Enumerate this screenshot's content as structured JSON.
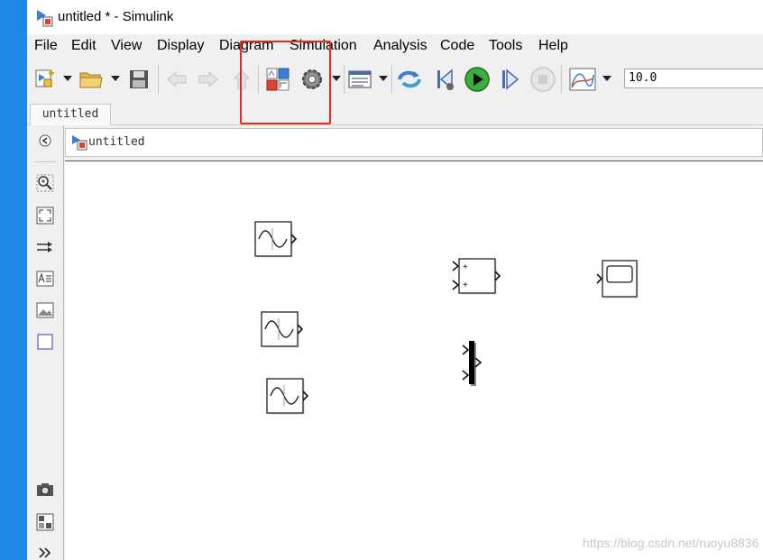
{
  "window": {
    "title": "untitled * - Simulink"
  },
  "menu": {
    "file": "File",
    "edit": "Edit",
    "view": "View",
    "display": "Display",
    "diagram": "Diagram",
    "simulation": "Simulation",
    "analysis": "Analysis",
    "code": "Code",
    "tools": "Tools",
    "help": "Help"
  },
  "toolbar": {
    "stop_time": "10.0"
  },
  "tabs": {
    "model_tab": "untitled"
  },
  "address": {
    "path": "untitled"
  },
  "blocks": {
    "sine1": "sine-wave",
    "sine2": "sine-wave",
    "sine3": "sine-wave",
    "sum": "sum",
    "mux": "mux",
    "scope": "scope"
  },
  "sum_block": {
    "sign1": "+",
    "sign2": "+"
  },
  "watermark": "https://blog.csdn.net/ruoyu8836",
  "colors": {
    "highlight": "#e8291c",
    "run_green": "#3cae3c",
    "desktop": "#1e88e5"
  }
}
